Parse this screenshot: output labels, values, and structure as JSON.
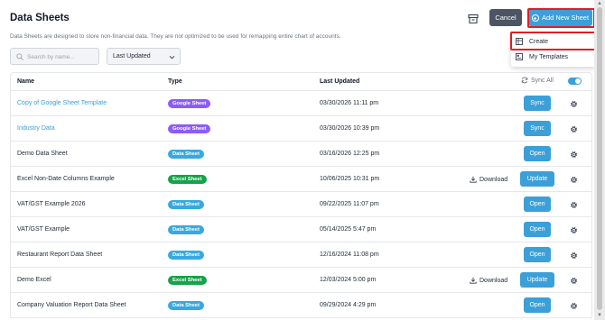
{
  "header": {
    "title": "Data Sheets",
    "description": "Data Sheets are designed to store non-financial data. They are not optimized to be used for remapping entire chart of accounts.",
    "cancel_label": "Cancel",
    "add_label": "Add New Sheet"
  },
  "dropdown": {
    "items": [
      {
        "label": "Create",
        "icon": "table-icon"
      },
      {
        "label": "My Templates",
        "icon": "template-icon"
      }
    ]
  },
  "filters": {
    "search_placeholder": "Search by name...",
    "search_value": "",
    "sort_selected": "Last Updated"
  },
  "table": {
    "columns": {
      "name": "Name",
      "type": "Type",
      "updated": "Last Updated"
    },
    "sync_all_label": "Sync All",
    "sync_all_enabled": true,
    "download_label": "Download",
    "rows": [
      {
        "name": "Copy of Google Sheet Template",
        "type": "Google Sheet",
        "updated": "03/30/2026 11:11 pm",
        "action": "Sync",
        "link": true
      },
      {
        "name": "Industry Data",
        "type": "Google Sheet",
        "updated": "03/30/2026 10:39 pm",
        "action": "Sync",
        "link": true
      },
      {
        "name": "Demo Data Sheet",
        "type": "Data Sheet",
        "updated": "03/16/2026 12:25 pm",
        "action": "Open",
        "link": false
      },
      {
        "name": "Excel Non-Date Columns Example",
        "type": "Excel Sheet",
        "updated": "10/06/2025 10:31 pm",
        "action": "Update",
        "link": false,
        "download": true
      },
      {
        "name": "VAT/GST Example 2026",
        "type": "Data Sheet",
        "updated": "09/22/2025 11:07 pm",
        "action": "Open",
        "link": false
      },
      {
        "name": "VAT/GST Example",
        "type": "Data Sheet",
        "updated": "05/14/2025 5:47 pm",
        "action": "Open",
        "link": false
      },
      {
        "name": "Restaurant Report Data Sheet",
        "type": "Data Sheet",
        "updated": "12/16/2024 11:08 pm",
        "action": "Open",
        "link": false
      },
      {
        "name": "Demo Excel",
        "type": "Excel Sheet",
        "updated": "12/03/2024 5:00 pm",
        "action": "Update",
        "link": false,
        "download": true
      },
      {
        "name": "Company Valuation Report Data Sheet",
        "type": "Data Sheet",
        "updated": "09/29/2024 4:29 pm",
        "action": "Open",
        "link": false
      }
    ]
  },
  "colors": {
    "accent": "#3b9fd8",
    "google_sheet": "#8b5cf6",
    "data_sheet": "#38a9e0",
    "excel_sheet": "#16a34a",
    "highlight": "#e11d25"
  }
}
